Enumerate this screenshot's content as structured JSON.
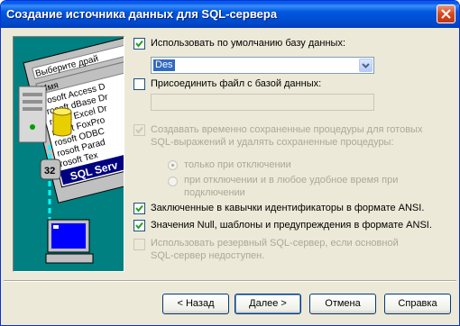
{
  "window": {
    "title": "Создание источника данных для SQL-сервера"
  },
  "illustration": {
    "dialog_tab": "Выберите драй",
    "column_header": "Имя",
    "list_items": [
      "rosoft Access D",
      "rosoft dBase Dr",
      "rosoft Excel Dr",
      "rosoft FoxPro",
      "rosoft ODBC",
      "rosoft Parad",
      "rosoft Tex"
    ],
    "banner": "SQL Serv",
    "badge": "32"
  },
  "options": {
    "default_db": {
      "label": "Использовать по умолчанию базу данных:",
      "checked": true,
      "enabled": true
    },
    "db_combo": {
      "value": "Des"
    },
    "attach_file": {
      "label": "Присоединить файл с базой данных:",
      "checked": false,
      "enabled": true
    },
    "attach_path": {
      "value": ""
    },
    "temp_procs": {
      "label_line1": "Создавать временно сохраненные процедуры для готовых",
      "label_line2": "SQL-выражений и удалять сохраненные процедуры:",
      "checked": true,
      "enabled": false
    },
    "radio_disconnect": {
      "label": "только при отключении",
      "selected": true,
      "enabled": false
    },
    "radio_anytime": {
      "label_line1": "при отключении и в любое удобное время при",
      "label_line2": "подключении",
      "selected": false,
      "enabled": false
    },
    "quoted_ids": {
      "label": "Заключенные в кавычки идентификаторы в формате ANSI.",
      "checked": true,
      "enabled": true
    },
    "ansi_nulls": {
      "label": "Значения Null, шаблоны и предупреждения в формате ANSI.",
      "checked": true,
      "enabled": true
    },
    "failover": {
      "label_line1": "Использовать резервный SQL-сервер, если основной",
      "label_line2": "SQL-сервер недоступен.",
      "checked": false,
      "enabled": false
    }
  },
  "buttons": {
    "back": "< Назад",
    "next": "Далее >",
    "cancel": "Отмена",
    "help": "Справка"
  }
}
